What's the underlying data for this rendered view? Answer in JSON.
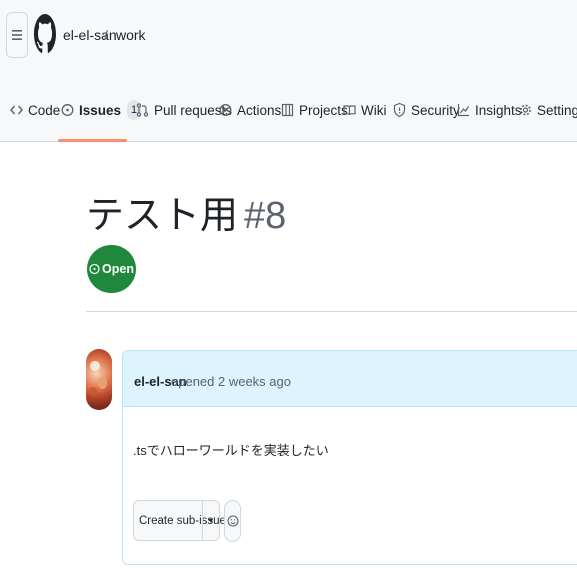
{
  "header": {
    "owner": "el-el-san",
    "separator": "/",
    "repo": "work"
  },
  "tabs": [
    {
      "label": "Code",
      "icon": "code-icon"
    },
    {
      "label": "Issues",
      "icon": "issue-opened-icon",
      "count": "1",
      "selected": true
    },
    {
      "label": "Pull requests",
      "icon": "git-pull-request-icon"
    },
    {
      "label": "Actions",
      "icon": "play-icon"
    },
    {
      "label": "Projects",
      "icon": "table-icon"
    },
    {
      "label": "Wiki",
      "icon": "book-icon"
    },
    {
      "label": "Security",
      "icon": "shield-icon"
    },
    {
      "label": "Insights",
      "icon": "graph-icon"
    },
    {
      "label": "Settings",
      "icon": "gear-icon"
    }
  ],
  "issue": {
    "title": "テスト用",
    "number": "#8",
    "state": "Open"
  },
  "comment": {
    "author": "el-el-san",
    "meta": "opened 2 weeks ago",
    "body": ".tsでハローワールドを実装したい",
    "create_sub_issue": "Create sub-issue",
    "caret": "▾"
  },
  "colors": {
    "accent_underline": "#fd8c73",
    "open_green": "#1f883d",
    "comment_header_bg": "#ddf4ff",
    "comment_border": "#b6e3ff"
  }
}
